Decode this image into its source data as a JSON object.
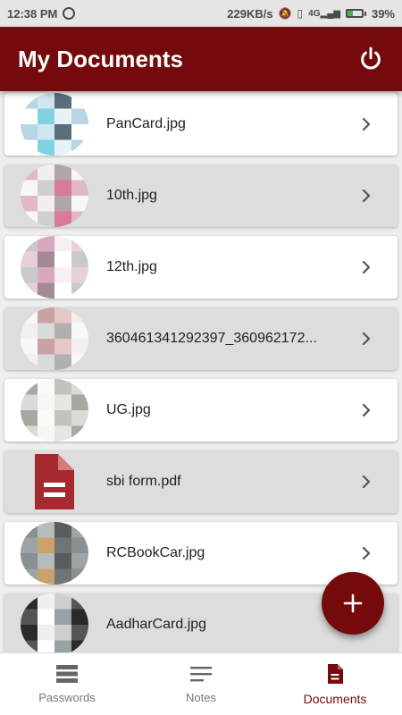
{
  "status_bar": {
    "time": "12:38 PM",
    "speed": "229KB/s",
    "network": "4G",
    "battery": "39%",
    "battery_fraction": 0.39
  },
  "header": {
    "title": "My Documents",
    "power_icon": "power-icon"
  },
  "documents": [
    {
      "name": "PanCard.jpg",
      "thumb": "blurred-image"
    },
    {
      "name": "10th.jpg",
      "thumb": "blurred-image"
    },
    {
      "name": "12th.jpg",
      "thumb": "blurred-image"
    },
    {
      "name": "360461341292397_360962172...",
      "thumb": "blurred-image"
    },
    {
      "name": "UG.jpg",
      "thumb": "blurred-image"
    },
    {
      "name": "sbi form.pdf",
      "thumb": "pdf-file-icon"
    },
    {
      "name": "RCBookCar.jpg",
      "thumb": "blurred-image"
    },
    {
      "name": "AadharCard.jpg",
      "thumb": "blurred-image"
    }
  ],
  "fab": {
    "icon": "plus-icon"
  },
  "bottom_nav": [
    {
      "label": "Passwords",
      "icon": "list-icon",
      "active": false
    },
    {
      "label": "Notes",
      "icon": "notes-icon",
      "active": false
    },
    {
      "label": "Documents",
      "icon": "document-icon",
      "active": true
    }
  ],
  "colors": {
    "primary": "#750a0c",
    "item_white": "#ffffff",
    "item_gray": "#dddddd"
  }
}
